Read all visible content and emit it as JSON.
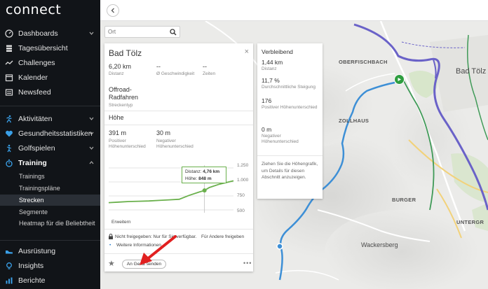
{
  "app": {
    "logo": "connect"
  },
  "sidebar": {
    "items": [
      {
        "label": "Dashboards",
        "icon": "dashboard-gauge-icon",
        "chevron": true
      },
      {
        "label": "Tagesübersicht",
        "icon": "layers-icon",
        "chevron": false
      },
      {
        "label": "Challenges",
        "icon": "challenges-wave-icon",
        "chevron": false
      },
      {
        "label": "Kalender",
        "icon": "calendar-icon",
        "chevron": false
      },
      {
        "label": "Newsfeed",
        "icon": "newsfeed-icon",
        "chevron": false
      },
      {
        "label": "Aktivitäten",
        "icon": "running-person-icon",
        "chevron": true
      },
      {
        "label": "Gesundheitsstatistiken",
        "icon": "heart-icon",
        "chevron": true
      },
      {
        "label": "Golfspielen",
        "icon": "golfer-icon",
        "chevron": true
      },
      {
        "label": "Training",
        "icon": "stopwatch-icon",
        "chevron": true
      }
    ],
    "training_sub": [
      {
        "label": "Trainings"
      },
      {
        "label": "Trainingspläne"
      },
      {
        "label": "Strecken"
      },
      {
        "label": "Segmente"
      },
      {
        "label": "Heatmap für die Beliebtheit"
      }
    ],
    "bottom_items": [
      {
        "label": "Ausrüstung",
        "icon": "shoe-icon"
      },
      {
        "label": "Insights",
        "icon": "lightbulb-icon"
      },
      {
        "label": "Berichte",
        "icon": "chart-report-icon"
      }
    ]
  },
  "map": {
    "search_placeholder": "Ort",
    "labels": {
      "oberfischbach": "OBERFISCHBACH",
      "badtoelz": "Bad Tölz",
      "zollhaus": "ZOLLHAUS",
      "burger": "BURGER",
      "wackersberg": "Wackersberg",
      "untergr": "UNTERGR"
    },
    "colors": {
      "route": "#3d8fd6",
      "river": "#6a62c8",
      "road_green": "#3f9a57",
      "start_marker": "#2e9d3f"
    }
  },
  "panel": {
    "title": "Bad Tölz",
    "close": "×",
    "stats": [
      {
        "value": "6,20 km",
        "label": "Distanz"
      },
      {
        "value": "--",
        "label": "Ø Geschwindigkeit"
      },
      {
        "value": "--",
        "label": "Zeiten"
      }
    ],
    "type_value": "Offroad-Radfahren",
    "type_label": "Streckentyp",
    "elevation_title": "Höhe",
    "elevation": [
      {
        "value": "391 m",
        "label": "Positiver Höhenunterschied"
      },
      {
        "value": "30 m",
        "label": "Negativer Höhenunterschied"
      }
    ],
    "y_ticks": [
      "1.250",
      "1.000",
      "750",
      "500"
    ],
    "tooltip": {
      "dist_label": "Distanz:",
      "dist_value": "4,76 km",
      "height_label": "Höhe:",
      "height_value": "848 m"
    },
    "expand_link": "Erweitern",
    "privacy_text": "Nicht freigegeben: Nur für Sie verfügbar.",
    "privacy_link": "Für Andere freigeben",
    "more_info_link": "Weitere Informationen",
    "send_button": "An Gerät senden",
    "more_dots": "•••"
  },
  "remaining": {
    "title": "Verbleibend",
    "items": [
      {
        "value": "1,44 km",
        "label": "Distanz"
      },
      {
        "value": "11,7 %",
        "label": "Durchschnittliche Steigung"
      },
      {
        "value": "176",
        "label": "Positiver Höhenunterschied"
      },
      {
        "value": "0 m",
        "label": "Negativer Höhenunterschied"
      }
    ],
    "hint": "Ziehen Sie die Höhengrafik, um Details für diesen Abschnitt anzuzeigen."
  },
  "chart_data": {
    "type": "line",
    "x": [
      0,
      0.5,
      1.0,
      1.5,
      2.0,
      2.5,
      3.0,
      3.5,
      4.0,
      4.5,
      4.76,
      5.0,
      5.5,
      6.2
    ],
    "series": [
      {
        "values": [
          630,
          640,
          650,
          655,
          660,
          670,
          680,
          690,
          760,
          820,
          848,
          900,
          960,
          1020
        ]
      }
    ],
    "ylim": [
      450,
      1300
    ],
    "xlim": [
      0,
      6.2
    ],
    "yticks": [
      500,
      750,
      1000,
      1250
    ],
    "grid": true,
    "color": "#6ab04c"
  }
}
